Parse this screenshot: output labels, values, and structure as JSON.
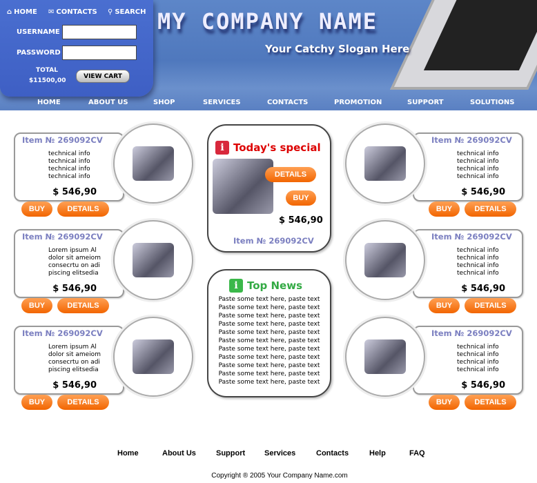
{
  "header": {
    "top_links": [
      "HOME",
      "CONTACTS",
      "SEARCH"
    ],
    "username_label": "USERNAME",
    "password_label": "PASSWORD",
    "username_value": "",
    "password_value": "",
    "total_label": "TOTAL",
    "total_value": "$11500,00",
    "view_cart": "VIEW CART",
    "company_name": "MY COMPANY NAME",
    "slogan": "Your Catchy Slogan Here"
  },
  "nav": [
    "HOME",
    "ABOUT US",
    "SHOP",
    "SERVICES",
    "CONTACTS",
    "PROMOTION",
    "SUPPORT",
    "SOLUTIONS"
  ],
  "products_left": [
    {
      "item": "Item № 269092CV",
      "desc": [
        "technical info",
        "technical info",
        "technical info",
        "technical info"
      ],
      "price": "$ 546,90",
      "image": "pocket-pc"
    },
    {
      "item": "Item № 269092CV",
      "desc": [
        "Lorem  ipsum Al",
        "dolor sit ameiom",
        "consecrtu on adi",
        "piscing  elitsedia"
      ],
      "price": "$ 546,90",
      "image": "laptop"
    },
    {
      "item": "Item № 269092CV",
      "desc": [
        "Lorem  ipsum Al",
        "dolor sit ameiom",
        "consecrtu on adi",
        "piscing  elitsedia"
      ],
      "price": "$ 546,90",
      "image": "desktop-tower"
    }
  ],
  "products_right": [
    {
      "item": "Item № 269092CV",
      "desc": [
        "technical info",
        "technical info",
        "technical info",
        "technical info"
      ],
      "price": "$ 546,90",
      "image": "desktop-pc"
    },
    {
      "item": "Item № 269092CV",
      "desc": [
        "technical info",
        "technical info",
        "technical info",
        "technical info"
      ],
      "price": "$ 546,90",
      "image": "tablet-laptop"
    },
    {
      "item": "Item № 269092CV",
      "desc": [
        "technical info",
        "technical info",
        "technical info",
        "technical info"
      ],
      "price": "$ 546,90",
      "image": "lcd-monitor"
    }
  ],
  "buttons": {
    "buy": "BUY",
    "details": "DETAILS"
  },
  "special": {
    "title": "Today's special",
    "details": "DETAILS",
    "buy": "BUY",
    "price": "$ 546,90",
    "item": "Item № 269092CV",
    "icon_letter": "i"
  },
  "news": {
    "title": "Top News",
    "icon_letter": "i",
    "lines": [
      "Paste some text here, paste text",
      "Paste some text here, paste text",
      "Paste some text here, paste text",
      "Paste some text here, paste text",
      "Paste some text here, paste text",
      "Paste some text here, paste text",
      "Paste some text here, paste text",
      "Paste some text here, paste text",
      "Paste some text here, paste text",
      "Paste some text here, paste text",
      "Paste some text here, paste text"
    ]
  },
  "footer": {
    "links": [
      "Home",
      "About Us",
      "Support",
      "Services",
      "Contacts",
      "Help",
      "FAQ"
    ],
    "copyright": "Copyright ® 2005 Your Company Name.com"
  },
  "colors": {
    "header_blue": "#5d86c8",
    "button_orange": "#f26500",
    "item_text": "#7b7fc0",
    "special_red": "#dd0000",
    "news_green": "#33aa44"
  }
}
